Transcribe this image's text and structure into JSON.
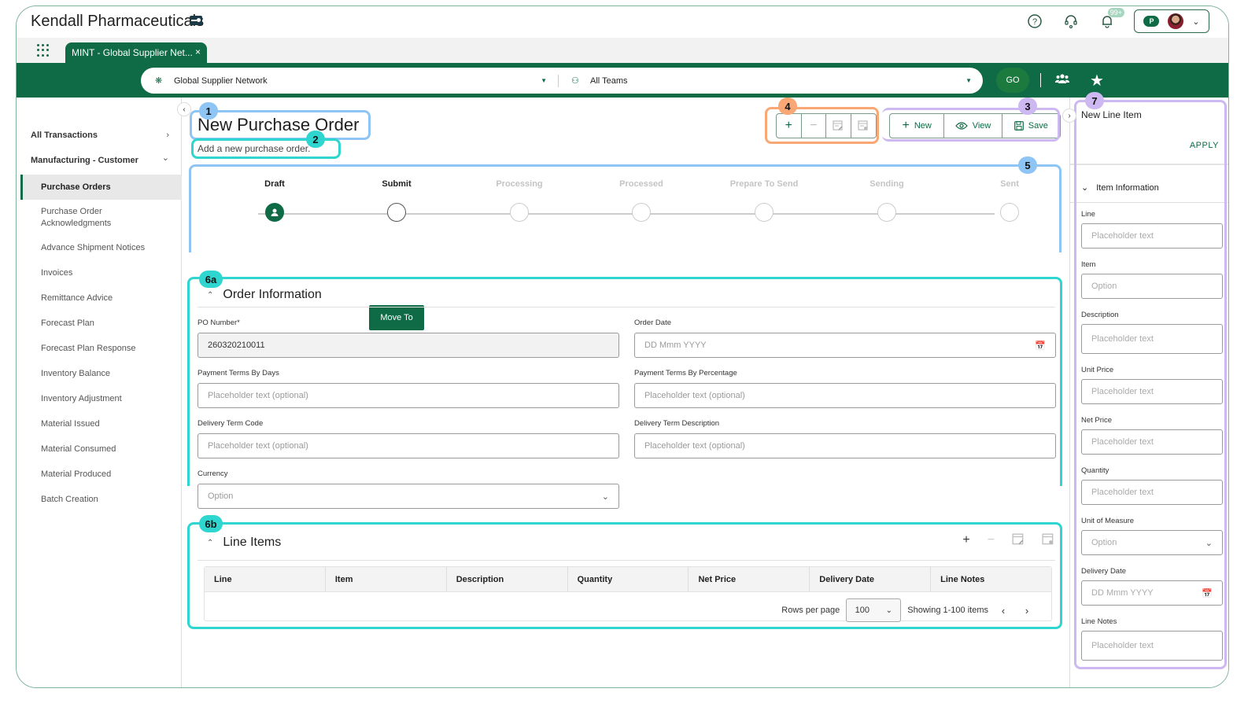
{
  "app": {
    "brand": "Kendall Pharmaceuticals",
    "notification_badge": "99+",
    "account_initial": "P"
  },
  "tabs": [
    {
      "label": "MINT - Global Supplier Net...",
      "close": "×"
    }
  ],
  "filters": {
    "network": "Global Supplier Network",
    "team": "All Teams",
    "go_label": "GO"
  },
  "sidebar": {
    "groups": [
      {
        "label": "All Transactions",
        "chevron": "›"
      },
      {
        "label": "Manufacturing - Customer",
        "chevron": "⌄"
      }
    ],
    "items": [
      {
        "label": "Purchase Orders",
        "active": true
      },
      {
        "label": "Purchase Order Acknowledgments"
      },
      {
        "label": "Advance Shipment Notices"
      },
      {
        "label": "Invoices"
      },
      {
        "label": "Remittance Advice"
      },
      {
        "label": "Forecast Plan"
      },
      {
        "label": "Forecast Plan Response"
      },
      {
        "label": "Inventory Balance"
      },
      {
        "label": "Inventory Adjustment"
      },
      {
        "label": "Material Issued"
      },
      {
        "label": "Material Consumed"
      },
      {
        "label": "Material Produced"
      },
      {
        "label": "Batch Creation"
      }
    ]
  },
  "page": {
    "title": "New Purchase Order",
    "subtitle": "Add a new purchase order."
  },
  "toolbar": {
    "icon_buttons": [
      "add-icon",
      "remove-icon",
      "edit-form-icon",
      "view-form-icon"
    ],
    "new_label": "New",
    "view_label": "View",
    "save_label": "Save"
  },
  "workflow": {
    "steps": [
      {
        "label": "Draft",
        "state": "done"
      },
      {
        "label": "Submit",
        "state": "next"
      },
      {
        "label": "Processing",
        "state": "pending"
      },
      {
        "label": "Processed",
        "state": "pending"
      },
      {
        "label": "Prepare To Send",
        "state": "pending"
      },
      {
        "label": "Sending",
        "state": "pending"
      },
      {
        "label": "Sent",
        "state": "pending"
      }
    ],
    "move_to_label": "Move To"
  },
  "order_info": {
    "title": "Order Information",
    "fields": {
      "po_number": {
        "label": "PO Number*",
        "value": "260320210011"
      },
      "order_date": {
        "label": "Order Date",
        "placeholder": "DD Mmm YYYY"
      },
      "pay_days": {
        "label": "Payment Terms By Days",
        "placeholder": "Placeholder text (optional)"
      },
      "pay_pct": {
        "label": "Payment Terms By Percentage",
        "placeholder": "Placeholder text (optional)"
      },
      "del_code": {
        "label": "Delivery Term Code",
        "placeholder": "Placeholder text (optional)"
      },
      "del_desc": {
        "label": "Delivery Term Description",
        "placeholder": "Placeholder text (optional)"
      },
      "currency": {
        "label": "Currency",
        "placeholder": "Option"
      }
    }
  },
  "line_items": {
    "title": "Line Items",
    "columns": [
      "Line",
      "Item",
      "Description",
      "Quantity",
      "Net Price",
      "Delivery Date",
      "Line Notes"
    ],
    "rows": [],
    "rows_per_page_label": "Rows per page",
    "rows_per_page": "100",
    "showing": "Showing 1-100 items"
  },
  "annotations": [
    "1",
    "2",
    "3",
    "4",
    "5",
    "6a",
    "6b",
    "7"
  ],
  "annotation_colors": {
    "blue": "#8ec5f5",
    "teal": "#2fd6d0",
    "purple": "#cdb8f2",
    "orange": "#f9a875"
  },
  "right_panel": {
    "title": "New Line Item",
    "apply_label": "APPLY",
    "section": "Item Information",
    "fields": [
      {
        "label": "Line",
        "placeholder": "Placeholder text"
      },
      {
        "label": "Item",
        "placeholder": "Option"
      },
      {
        "label": "Description",
        "placeholder": "Placeholder text"
      },
      {
        "label": "Unit Price",
        "placeholder": "Placeholder text"
      },
      {
        "label": "Net Price",
        "placeholder": "Placeholder text"
      },
      {
        "label": "Quantity",
        "placeholder": "Placeholder text"
      },
      {
        "label": "Unit of Measure",
        "placeholder": "Option"
      },
      {
        "label": "Delivery Date",
        "placeholder": "DD Mmm YYYY"
      },
      {
        "label": "Line Notes",
        "placeholder": "Placeholder text"
      }
    ]
  },
  "colors": {
    "brand_green": "#0e6b46",
    "go_green": "#1c7a3f"
  }
}
